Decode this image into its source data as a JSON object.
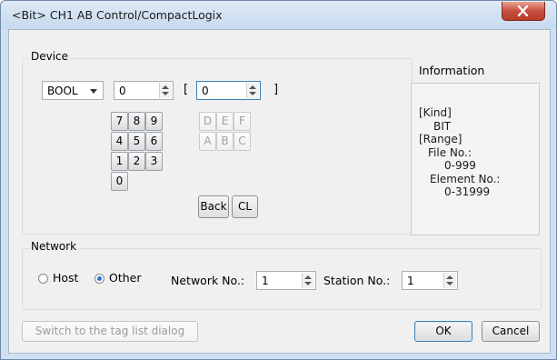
{
  "window": {
    "title": "<Bit> CH1 AB Control/CompactLogix"
  },
  "device": {
    "group_label": "Device",
    "type_select": {
      "value": "BOOL"
    },
    "file_no": {
      "value": "0"
    },
    "bracket_open": "[",
    "element_no": {
      "value": "0"
    },
    "bracket_close": "]",
    "keypad": {
      "digits": [
        "7",
        "8",
        "9",
        "4",
        "5",
        "6",
        "1",
        "2",
        "3",
        "0"
      ],
      "hex": [
        "D",
        "E",
        "F",
        "A",
        "B",
        "C"
      ],
      "back_label": "Back",
      "clear_label": "CL"
    }
  },
  "information": {
    "heading": "Information",
    "kind_label": "[Kind]",
    "kind_value": "BIT",
    "range_label": "[Range]",
    "file_no_label": "File No.:",
    "file_no_range": "0-999",
    "element_no_label": "Element No.:",
    "element_no_range": "0-31999"
  },
  "network": {
    "group_label": "Network",
    "host_label": "Host",
    "other_label": "Other",
    "selected": "Other",
    "network_no_label": "Network No.:",
    "network_no_value": "1",
    "station_no_label": "Station No.:",
    "station_no_value": "1"
  },
  "footer": {
    "tag_list_label": "Switch to the tag list dialog",
    "ok_label": "OK",
    "cancel_label": "Cancel"
  }
}
